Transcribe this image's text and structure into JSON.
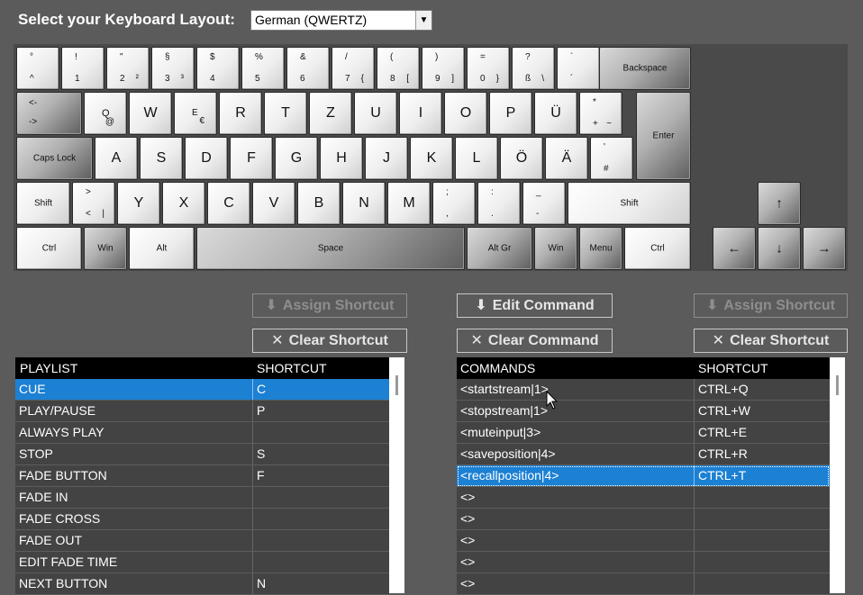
{
  "header": {
    "label": "Select your Keyboard Layout:",
    "layout_value": "German (QWERTZ)"
  },
  "keyboard": {
    "row1": [
      {
        "tl": "°",
        "bl": "^"
      },
      {
        "tl": "!",
        "bl": "1"
      },
      {
        "tl": "\"",
        "bl": "2",
        "br": "²"
      },
      {
        "tl": "§",
        "bl": "3",
        "br": "³"
      },
      {
        "tl": "$",
        "bl": "4"
      },
      {
        "tl": "%",
        "bl": "5"
      },
      {
        "tl": "&",
        "bl": "6"
      },
      {
        "tl": "/",
        "bl": "7",
        "br": "{"
      },
      {
        "tl": "(",
        "bl": "8",
        "br": "["
      },
      {
        "tl": ")",
        "bl": "9",
        "br": "]"
      },
      {
        "tl": "=",
        "bl": "0",
        "br": "}"
      },
      {
        "tl": "?",
        "bl": "ß",
        "br": "\\"
      },
      {
        "tl": "`",
        "bl": "´"
      }
    ],
    "backspace": "Backspace",
    "tab_top": "<-",
    "tab_bottom": "->",
    "row2_letters": [
      "W",
      "R",
      "T",
      "Z",
      "U",
      "I",
      "O",
      "P",
      "Ü"
    ],
    "q_key": {
      "main": "Q",
      "sub": "@"
    },
    "e_key": {
      "main": "E",
      "sub": "€"
    },
    "plus_key": {
      "tl": "*",
      "bl": "+",
      "br": "~"
    },
    "enter": "Enter",
    "caps": "Caps Lock",
    "row3_letters": [
      "A",
      "S",
      "D",
      "F",
      "G",
      "H",
      "J",
      "K",
      "L",
      "Ö",
      "Ä"
    ],
    "hash_key": {
      "tl": "'",
      "bl": "#"
    },
    "shift_left": "Shift",
    "angle_key": {
      "tl": ">",
      "bl": "<",
      "br": "|"
    },
    "row4_letters": [
      "Y",
      "X",
      "C",
      "V",
      "B",
      "N",
      "M"
    ],
    "semicolon_key": {
      "tl": ";",
      "bl": ","
    },
    "colon_key": {
      "tl": ":",
      "bl": "."
    },
    "underscore_key": {
      "tl": "_",
      "bl": "-"
    },
    "shift_right": "Shift",
    "ctrl_left": "Ctrl",
    "win_left": "Win",
    "alt": "Alt",
    "space": "Space",
    "altgr": "Alt Gr",
    "win_right": "Win",
    "menu": "Menu",
    "ctrl_right": "Ctrl",
    "arrow_up": "↑",
    "arrow_left": "←",
    "arrow_down": "↓",
    "arrow_right": "→"
  },
  "buttons": {
    "assign_left": "Assign Shortcut",
    "clear_left": "Clear Shortcut",
    "edit_command": "Edit Command",
    "clear_command": "Clear Command",
    "assign_right": "Assign Shortcut",
    "clear_right": "Clear Shortcut"
  },
  "playlist": {
    "headers": [
      "PLAYLIST",
      "SHORTCUT"
    ],
    "rows": [
      [
        "CUE",
        "C"
      ],
      [
        "PLAY/PAUSE",
        "P"
      ],
      [
        "ALWAYS PLAY",
        ""
      ],
      [
        "STOP",
        "S"
      ],
      [
        "FADE BUTTON",
        "F"
      ],
      [
        "FADE IN",
        ""
      ],
      [
        "FADE CROSS",
        ""
      ],
      [
        "FADE OUT",
        ""
      ],
      [
        "EDIT FADE TIME",
        ""
      ],
      [
        "NEXT BUTTON",
        "N"
      ]
    ],
    "selected_index": 0
  },
  "commands": {
    "headers": [
      "COMMANDS",
      "SHORTCUT"
    ],
    "rows": [
      [
        "<startstream|1>",
        "CTRL+Q"
      ],
      [
        "<stopstream|1>",
        "CTRL+W"
      ],
      [
        "<muteinput|3>",
        "CTRL+E"
      ],
      [
        "<saveposition|4>",
        "CTRL+R"
      ],
      [
        "<recallposition|4>",
        "CTRL+T"
      ],
      [
        "<>",
        ""
      ],
      [
        "<>",
        ""
      ],
      [
        "<>",
        ""
      ],
      [
        "<>",
        ""
      ],
      [
        "<>",
        ""
      ]
    ],
    "selected_index": 4
  },
  "colors": {
    "selection": "#1c80d3",
    "header_bg": "#000000",
    "page_bg": "#5b5b5b"
  }
}
